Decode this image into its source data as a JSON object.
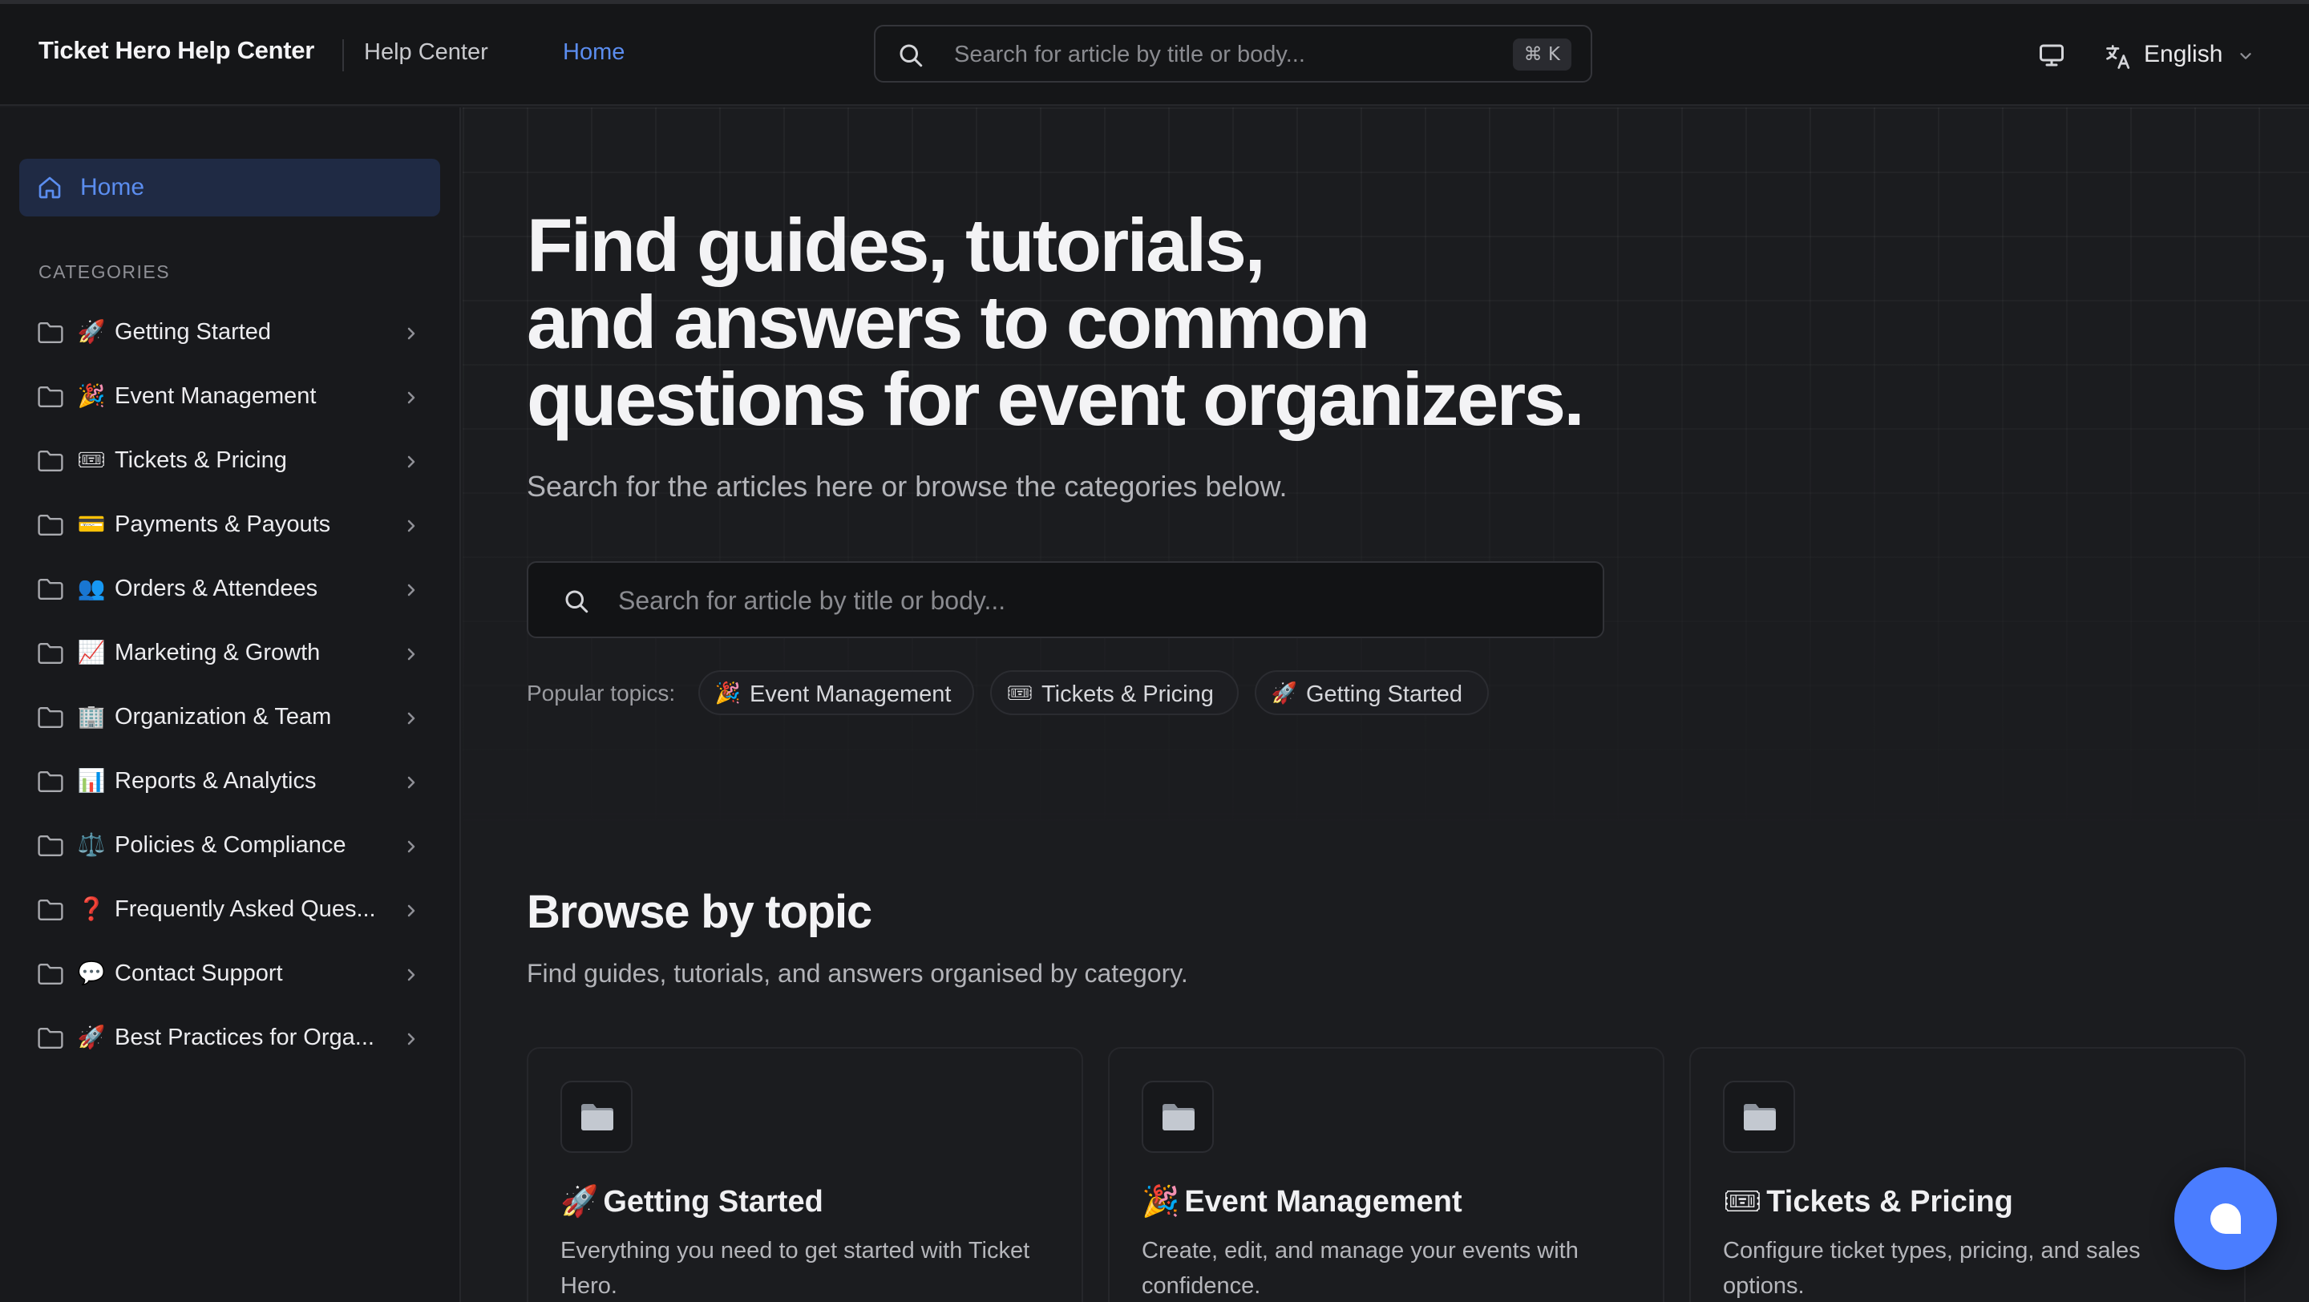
{
  "header": {
    "brand": "Ticket Hero Help Center",
    "nav_help_center": "Help Center",
    "nav_home": "Home",
    "search_placeholder": "Search for article by title or body...",
    "shortcut": "⌘ K",
    "language": "English",
    "icons": [
      "search-icon",
      "monitor-icon",
      "translate-icon",
      "chevron-down-icon"
    ]
  },
  "sidebar": {
    "home_label": "Home",
    "categories_title": "CATEGORIES",
    "items": [
      {
        "emoji": "🚀",
        "label": "Getting Started"
      },
      {
        "emoji": "🎉",
        "label": "Event Management"
      },
      {
        "emoji": "🎟",
        "label": "Tickets & Pricing"
      },
      {
        "emoji": "💳",
        "label": "Payments & Payouts"
      },
      {
        "emoji": "👥",
        "label": "Orders & Attendees"
      },
      {
        "emoji": "📈",
        "label": "Marketing & Growth"
      },
      {
        "emoji": "🏢",
        "label": "Organization & Team"
      },
      {
        "emoji": "📊",
        "label": "Reports & Analytics"
      },
      {
        "emoji": "⚖️",
        "label": "Policies & Compliance"
      },
      {
        "emoji": "❓",
        "label": "Frequently Asked Ques..."
      },
      {
        "emoji": "💬",
        "label": "Contact Support"
      },
      {
        "emoji": "🚀",
        "label": "Best Practices for Orga..."
      }
    ]
  },
  "hero": {
    "title_line1": "Find guides, tutorials,",
    "title_line2": "and answers to common",
    "title_line3": "questions for event organizers.",
    "subtitle": "Search for the articles here or browse the categories below.",
    "search_placeholder": "Search for article by title or body...",
    "popular_label": "Popular topics:",
    "popular_topics": [
      {
        "emoji": "🎉",
        "label": "Event Management"
      },
      {
        "emoji": "🎟",
        "label": "Tickets & Pricing"
      },
      {
        "emoji": "🚀",
        "label": "Getting Started"
      }
    ]
  },
  "browse": {
    "title": "Browse by topic",
    "subtitle": "Find guides, tutorials, and answers organised by category.",
    "cards": [
      {
        "emoji": "🚀",
        "title": "Getting Started",
        "description": "Everything you need to get started with Ticket Hero."
      },
      {
        "emoji": "🎉",
        "title": "Event Management",
        "description": "Create, edit, and manage your events with confidence."
      },
      {
        "emoji": "🎟",
        "title": "Tickets & Pricing",
        "description": "Configure ticket types, pricing, and sales options."
      }
    ]
  },
  "colors": {
    "accent": "#5b8def",
    "chat_button": "#4a7dff",
    "background": "#1b1c1f",
    "header_bg": "#151618"
  }
}
